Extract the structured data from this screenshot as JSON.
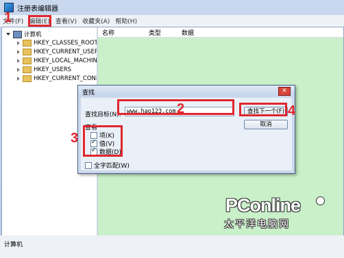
{
  "window": {
    "title": "注册表编辑器"
  },
  "menu": [
    {
      "label": "文件(F)"
    },
    {
      "label": "编辑(E)"
    },
    {
      "label": "查看(V)"
    },
    {
      "label": "收藏夹(A)"
    },
    {
      "label": "帮助(H)"
    }
  ],
  "tree": {
    "root": "计算机",
    "items": [
      "HKEY_CLASSES_ROOT",
      "HKEY_CURRENT_USER",
      "HKEY_LOCAL_MACHINE",
      "HKEY_USERS",
      "HKEY_CURRENT_CONFIG"
    ]
  },
  "list": {
    "columns": [
      "名称",
      "类型",
      "数据"
    ]
  },
  "status": {
    "path": "计算机"
  },
  "dialog": {
    "title": "查找",
    "close": "✕",
    "find_label": "查找目标(N):",
    "find_value": "www.hao123.com",
    "find_next": "查找下一个(F)",
    "cancel": "取消",
    "group_label": "查看",
    "options": [
      {
        "label": "项(K)",
        "checked": false
      },
      {
        "label": "值(V)",
        "checked": true
      },
      {
        "label": "数据(D)",
        "checked": true
      }
    ],
    "whole_match": {
      "label": "全字匹配(W)",
      "checked": false
    }
  },
  "annotations": [
    "1",
    "2",
    "3",
    "4"
  ],
  "watermark": {
    "brand": "PConline",
    "sub": "太平洋电脑网"
  },
  "colors": {
    "callout": "#e0262d",
    "list_bg": "#c9f0c9"
  }
}
